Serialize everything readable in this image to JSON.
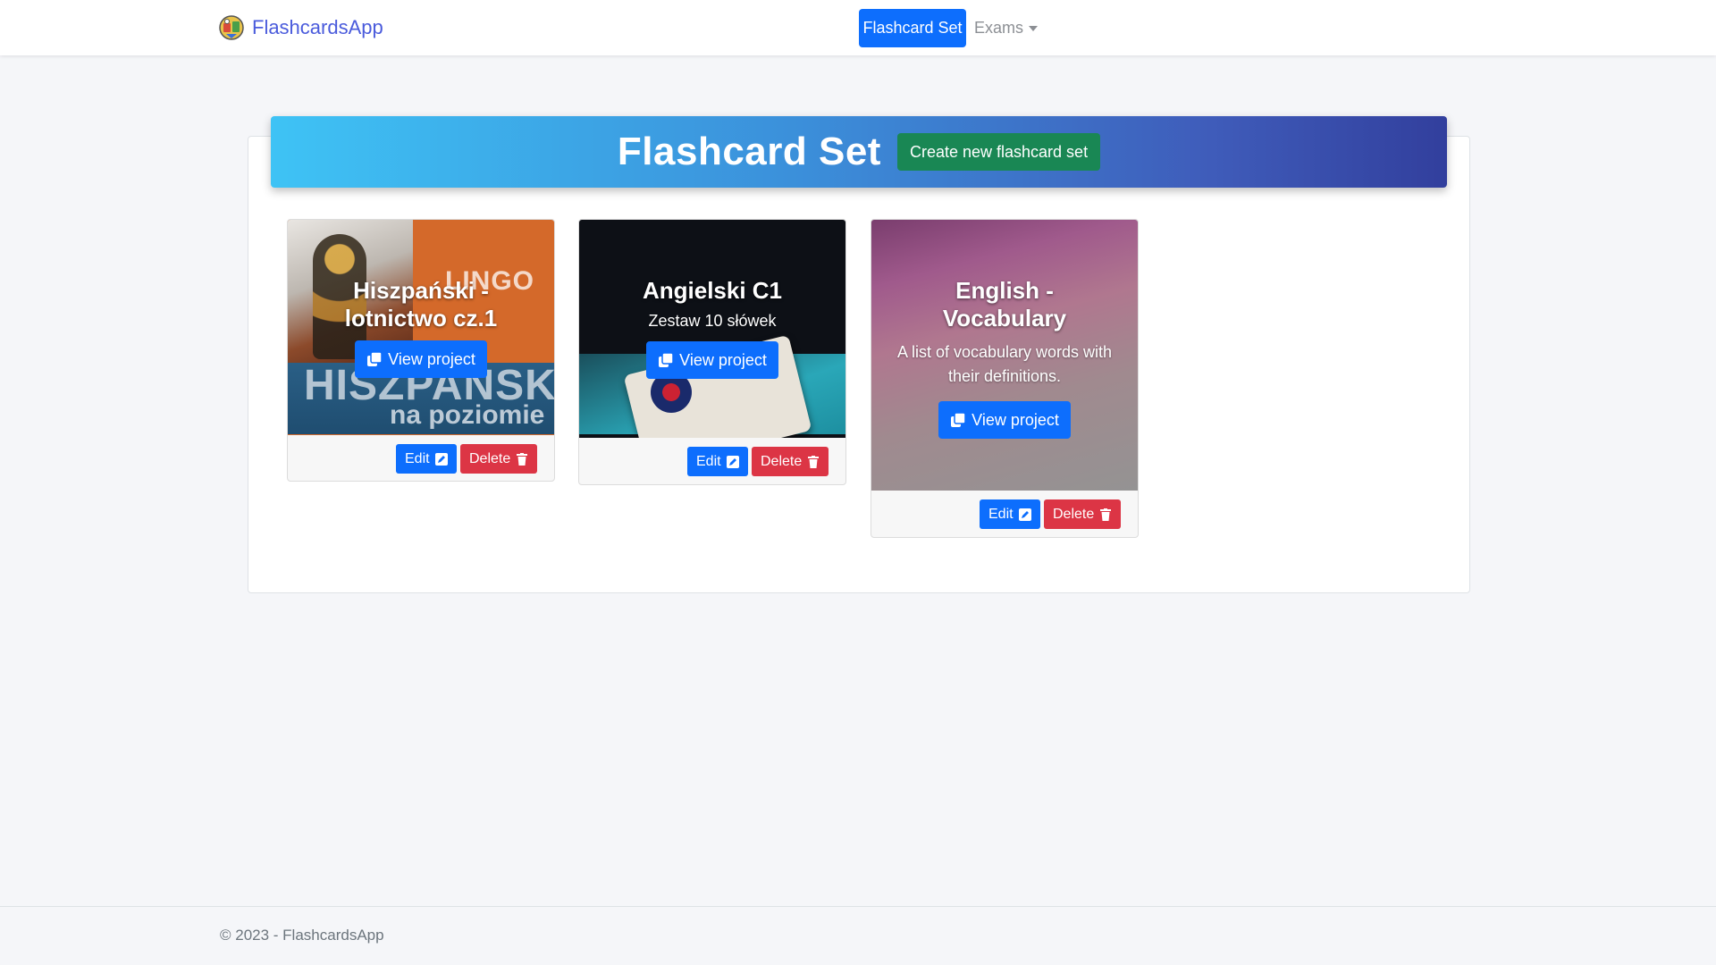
{
  "navbar": {
    "brand": "FlashcardsApp",
    "links": [
      {
        "label": "Flashcard Set",
        "active": true
      },
      {
        "label": "Exams",
        "dropdown": true
      }
    ]
  },
  "hero": {
    "title": "Flashcard Set",
    "create_button": "Create new flashcard set"
  },
  "cards": [
    {
      "title": "Hiszpański - lotnictwo cz.1",
      "subtitle": "",
      "image_text": [
        "LINGO",
        "HISZPAŃSKI",
        "na poziomie"
      ],
      "view_button": "View project",
      "edit_button": "Edit",
      "delete_button": "Delete"
    },
    {
      "title": "Angielski C1",
      "subtitle": "Zestaw 10 słówek",
      "view_button": "View project",
      "edit_button": "Edit",
      "delete_button": "Delete"
    },
    {
      "title": "English - Vocabulary",
      "subtitle": "A list of vocabulary words with their definitions.",
      "view_button": "View project",
      "edit_button": "Edit",
      "delete_button": "Delete"
    }
  ],
  "icons": {
    "view": "copy-icon",
    "edit": "pencil-square-icon",
    "delete": "trash-icon",
    "brand": "app-logo-icon"
  },
  "colors": {
    "primary": "#0d6efd",
    "success": "#198754",
    "danger": "#dc3545",
    "brand": "#4a5bdc"
  },
  "footer": {
    "text": "© 2023 - FlashcardsApp"
  }
}
